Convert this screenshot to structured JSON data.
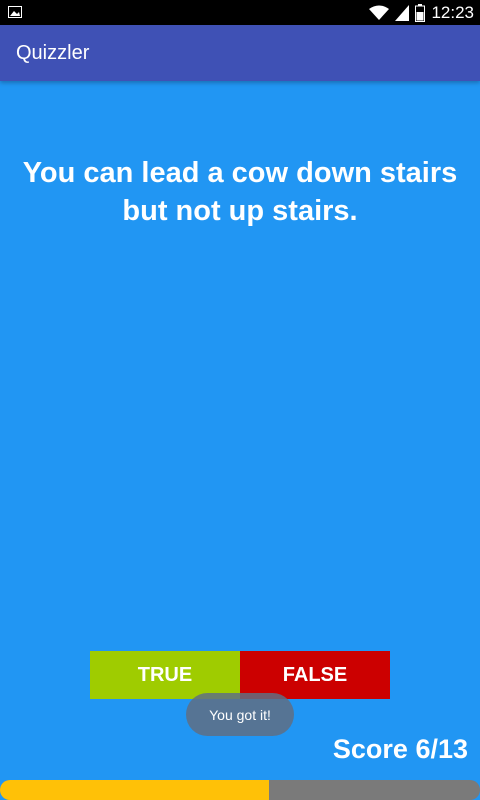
{
  "status_bar": {
    "time": "12:23",
    "left_icon": "image-icon",
    "wifi_icon": "wifi-icon",
    "signal_icon": "signal-icon",
    "battery_icon": "battery-icon"
  },
  "app_bar": {
    "title": "Quizzler"
  },
  "quiz": {
    "question": "You can lead a cow down stairs but not up stairs.",
    "true_label": "TRUE",
    "false_label": "FALSE",
    "toast": "You got it!",
    "score": "Score 6/13",
    "progress_fraction": 0.56
  },
  "colors": {
    "background": "#2196F3",
    "app_bar": "#3F51B5",
    "true_button": "#9FCC00",
    "false_button": "#CC0000",
    "progress_fill": "#FFC107",
    "progress_track": "#7a7a7a"
  }
}
